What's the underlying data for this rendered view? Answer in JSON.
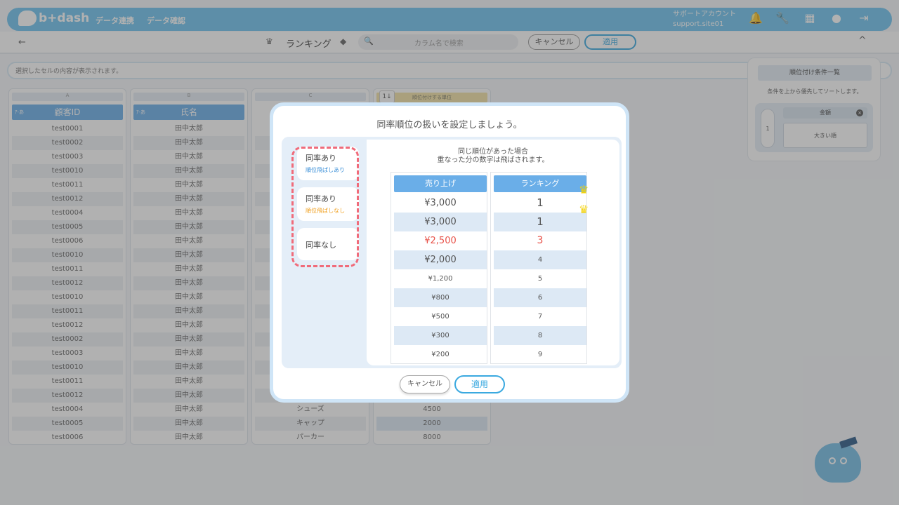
{
  "header": {
    "logo": "b+dash",
    "nav": [
      "データ連携",
      "データ確認"
    ],
    "account": {
      "name": "サポートアカウント",
      "site": "support.site01"
    }
  },
  "toolbar": {
    "back": "←",
    "title": "ランキング",
    "search_placeholder": "カラム名で検索",
    "cancel": "キャンセル",
    "apply": "適用",
    "collapse": "^"
  },
  "info_bar": "選択したセルの内容が表示されます。",
  "grid": {
    "columns": [
      {
        "letter": "A",
        "tag": "ｱ-あ",
        "header": "顧客ID"
      },
      {
        "letter": "B",
        "tag": "ｱ-あ",
        "header": "氏名"
      },
      {
        "letter": "C",
        "header": ""
      },
      {
        "sort": "1↓",
        "header": "順位付けする単位"
      }
    ],
    "col_a": [
      "test0001",
      "test0002",
      "test0003",
      "test0010",
      "test0011",
      "test0012",
      "test0004",
      "test0005",
      "test0006",
      "test0010",
      "test0011",
      "test0012",
      "test0010",
      "test0011",
      "test0012",
      "test0002",
      "test0003",
      "test0010",
      "test0011",
      "test0012",
      "test0004",
      "test0005",
      "test0006"
    ],
    "col_b": "田中太郎",
    "col_c_tail": [
      "シューズ",
      "キャップ",
      "パーカー"
    ],
    "col_d_tail": [
      "4500",
      "2000",
      "8000"
    ]
  },
  "ranking_panel": {
    "title": "順位付け条件一覧",
    "subtitle": "条件を上から優先してソートします。",
    "priority": "1",
    "field": "金額",
    "condition": "大きい順"
  },
  "modal": {
    "title": "同率順位の扱いを設定しましょう。",
    "options": [
      {
        "label": "同率あり",
        "sub": "順位飛ばしあり",
        "sub_color": "#3a8fd8"
      },
      {
        "label": "同率あり",
        "sub": "順位飛ばしなし",
        "sub_color": "#f0a020"
      },
      {
        "label": "同率なし",
        "sub": ""
      }
    ],
    "description": [
      "同じ順位があった場合",
      "重なった分の数字は飛ばされます。"
    ],
    "table": {
      "headers": [
        "売り上げ",
        "ランキング"
      ],
      "sales": [
        "¥3,000",
        "¥3,000",
        "¥2,500",
        "¥2,000",
        "¥1,200",
        "¥800",
        "¥500",
        "¥300",
        "¥200"
      ],
      "ranks": [
        "1",
        "1",
        "3",
        "4",
        "5",
        "6",
        "7",
        "8",
        "9"
      ]
    },
    "highlight_color": "#e8534a",
    "cancel": "キャンセル",
    "apply": "適用"
  }
}
